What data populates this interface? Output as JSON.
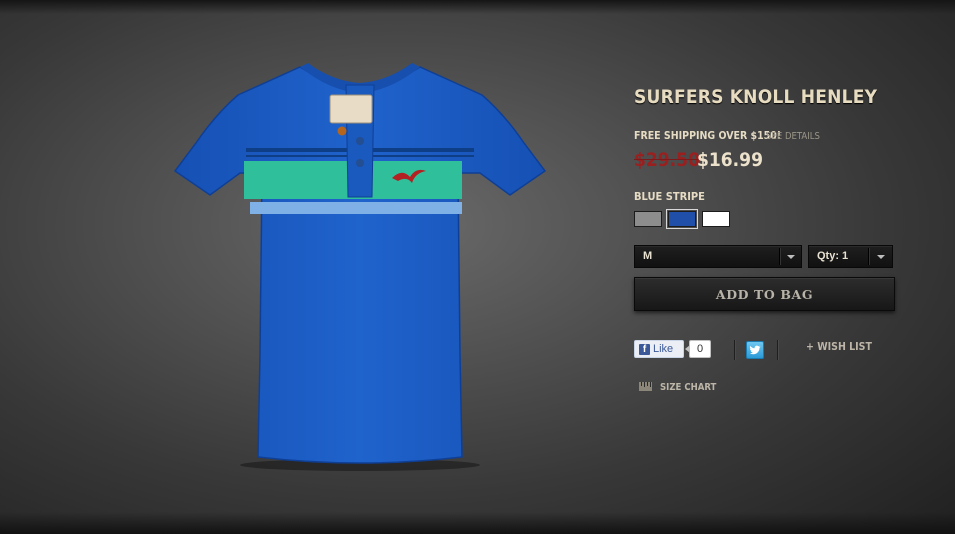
{
  "product": {
    "title": "SURFERS KNOLL HENLEY",
    "shipping": "FREE SHIPPING OVER $150!",
    "see_details": "SEE DETAILS",
    "old_price": "$29.50",
    "new_price": "$16.99",
    "color_name": "BLUE STRIPE"
  },
  "swatches": [
    {
      "name": "grey",
      "color": "#8d8d8d",
      "selected": false
    },
    {
      "name": "blue",
      "color": "#1f4fa8",
      "selected": true
    },
    {
      "name": "white",
      "color": "#ffffff",
      "selected": false
    }
  ],
  "size_select": {
    "value": "M"
  },
  "qty_select": {
    "value": "Qty: 1"
  },
  "add_to_bag": "ADD TO BAG",
  "social": {
    "like_label": "Like",
    "like_count": "0",
    "wish_list": "+ WISH LIST"
  },
  "size_chart": "SIZE CHART",
  "colors": {
    "shirt": "#1e5fc4",
    "stripe_green": "#2fbf9a",
    "stripe_light": "#7fb0e6",
    "sale_red": "#9a1f1f",
    "title_cream": "#e8dcc0"
  }
}
